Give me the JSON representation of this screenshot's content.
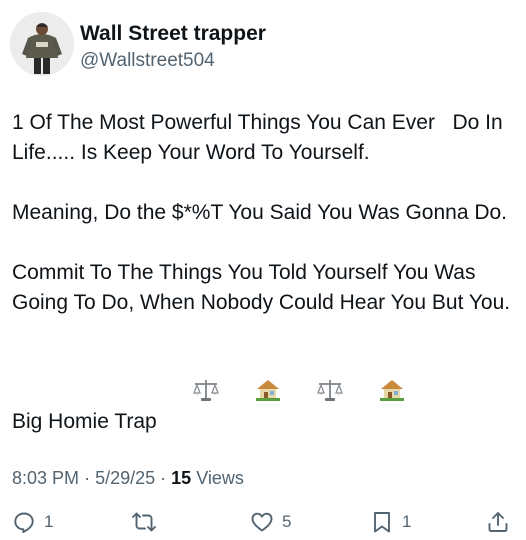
{
  "author": {
    "name": "Wall Street trapper",
    "handle": "@Wallstreet504"
  },
  "tweet": {
    "paragraphs": [
      "1 Of The Most Powerful Things You Can Ever   Do In Life..... Is Keep Your Word To Yourself.",
      "Meaning, Do the $*%T You Said You Was Gonna Do.",
      "Commit To The Things You Told Yourself You Was Going To Do, When Nobody Could Hear You But You.",
      "Big Homie Trap"
    ],
    "trailing_emojis": [
      "balance-scale",
      "house-with-garden",
      "balance-scale",
      "house-with-garden"
    ]
  },
  "meta": {
    "time": "8:03 PM",
    "sep1": "·",
    "date": "5/29/25",
    "sep2": "·",
    "views_count": "15",
    "views_label": "Views"
  },
  "actions": {
    "reply_count": "1",
    "retweet_count": "",
    "like_count": "5",
    "bookmark_count": "1"
  },
  "colors": {
    "text": "#0f1419",
    "secondary": "#536471"
  }
}
